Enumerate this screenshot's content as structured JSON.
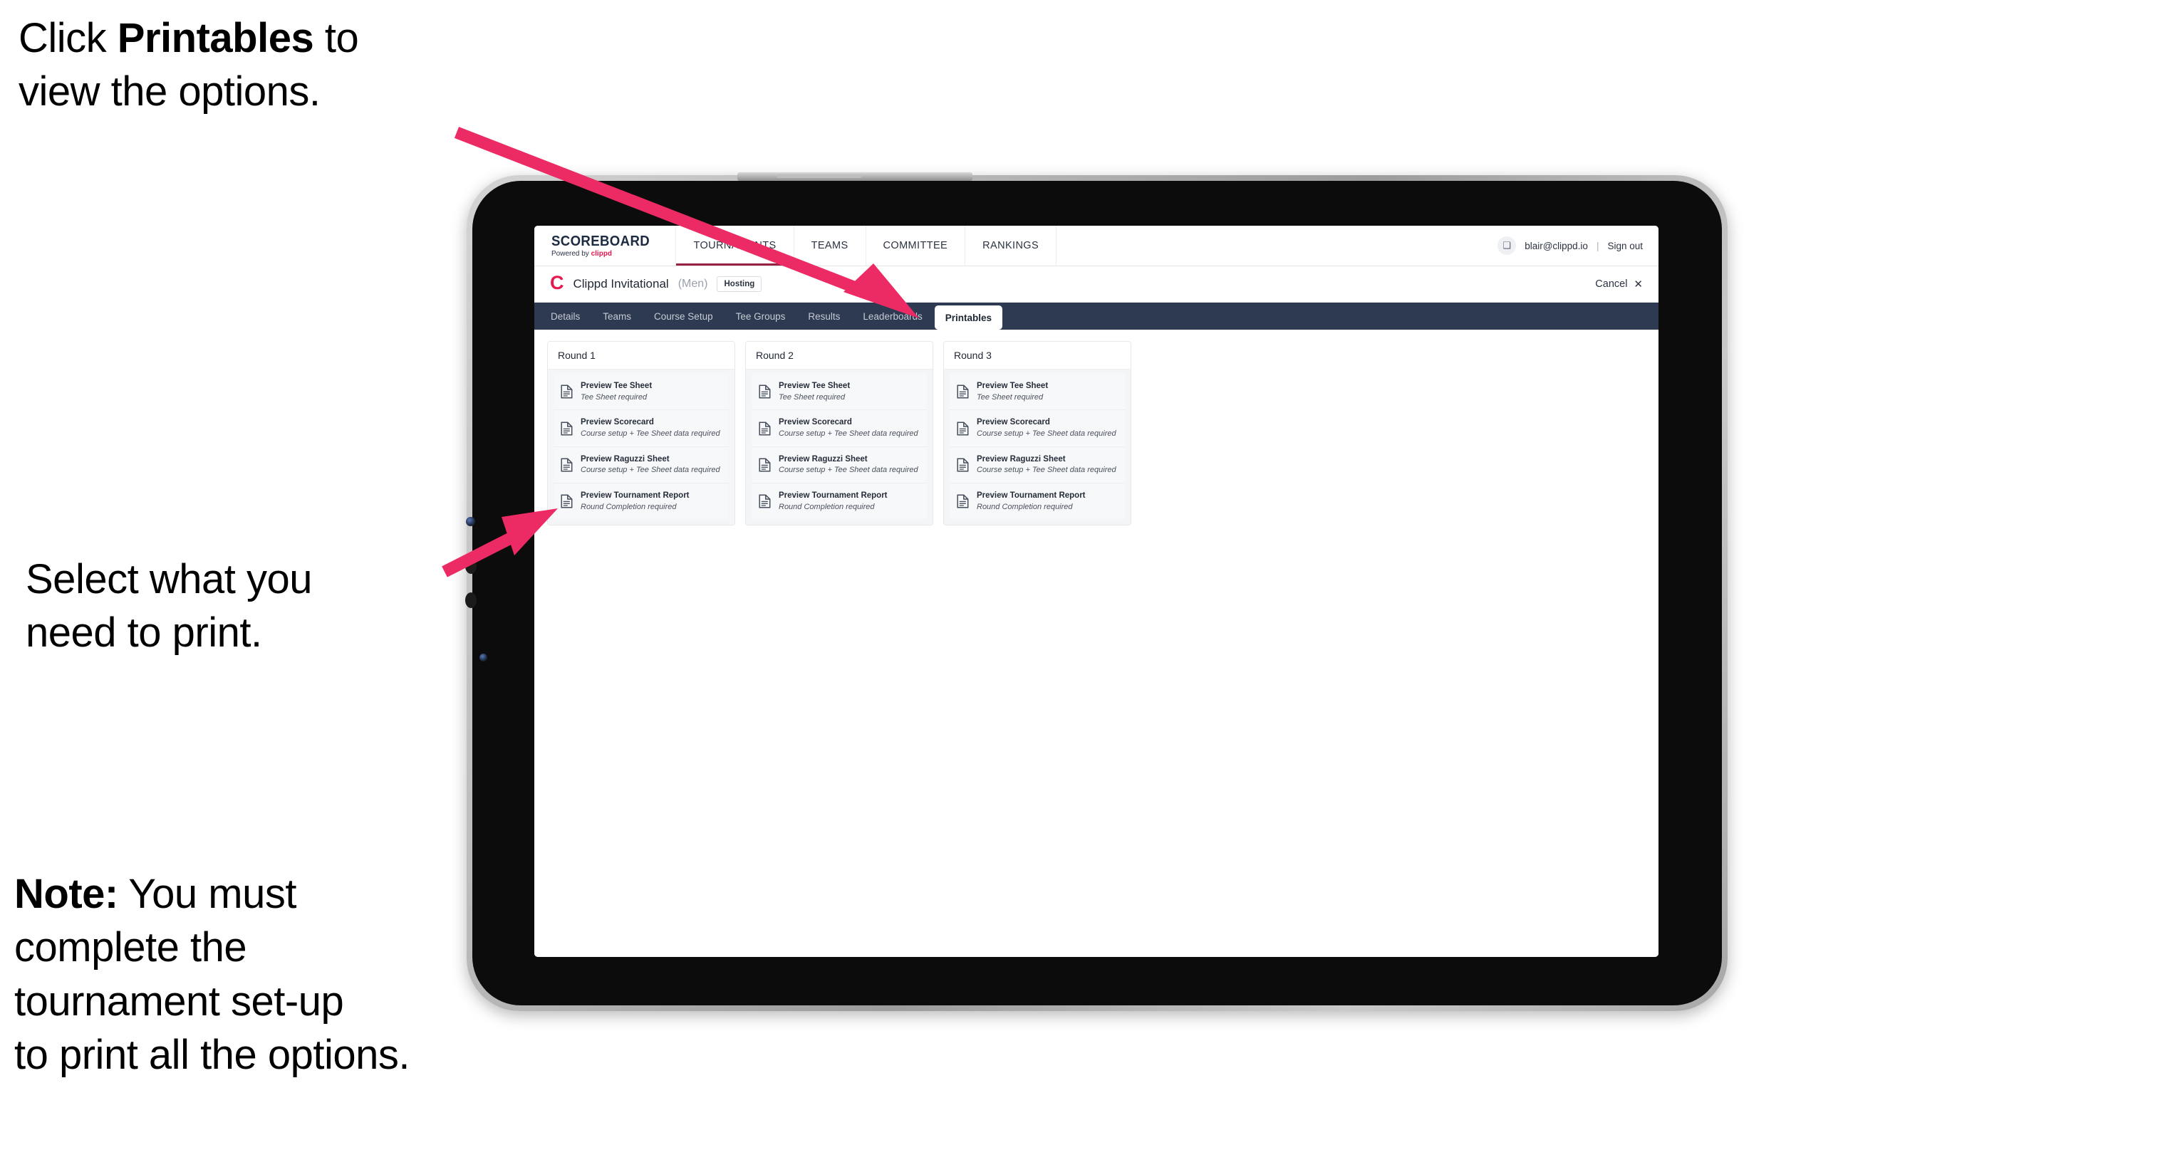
{
  "annotations": [
    {
      "id": "annot-click-printables",
      "text_before": "Click ",
      "text_bold": "Printables",
      "text_after": " to\nview the options."
    },
    {
      "id": "annot-select-print",
      "text_before": "",
      "text_bold": "",
      "text_after": "Select what you\n need to print."
    },
    {
      "id": "annot-note",
      "text_before": "",
      "text_bold": "Note:",
      "text_after": " You must\ncomplete the\ntournament set-up\nto print all the options."
    }
  ],
  "annotation_color": "#000000",
  "arrow_color": "#ec2a63",
  "app": {
    "brand": {
      "name": "SCOREBOARD",
      "powered_prefix": "Powered by ",
      "powered_brand": "clippd"
    },
    "topnav": [
      {
        "label": "TOURNAMENTS",
        "active": true
      },
      {
        "label": "TEAMS",
        "active": false
      },
      {
        "label": "COMMITTEE",
        "active": false
      },
      {
        "label": "RANKINGS",
        "active": false
      }
    ],
    "account": {
      "avatar_glyph": "❑",
      "email": "blair@clippd.io",
      "separator": "|",
      "sign_out": "Sign out"
    },
    "titlebar": {
      "logo_letter": "C",
      "tournament_name": "Clippd Invitational",
      "gender": "(Men)",
      "role_badge": "Hosting",
      "cancel_label": "Cancel",
      "cancel_icon": "✕"
    },
    "tabs": [
      {
        "label": "Details",
        "active": false
      },
      {
        "label": "Teams",
        "active": false
      },
      {
        "label": "Course Setup",
        "active": false
      },
      {
        "label": "Tee Groups",
        "active": false
      },
      {
        "label": "Results",
        "active": false
      },
      {
        "label": "Leaderboards",
        "active": false
      },
      {
        "label": "Printables",
        "active": true
      }
    ],
    "rounds": [
      {
        "title": "Round 1",
        "items": [
          {
            "title": "Preview Tee Sheet",
            "requirement": "Tee Sheet required"
          },
          {
            "title": "Preview Scorecard",
            "requirement": "Course setup + Tee Sheet data required"
          },
          {
            "title": "Preview Raguzzi Sheet",
            "requirement": "Course setup + Tee Sheet data required"
          },
          {
            "title": "Preview Tournament Report",
            "requirement": "Round Completion required"
          }
        ]
      },
      {
        "title": "Round 2",
        "items": [
          {
            "title": "Preview Tee Sheet",
            "requirement": "Tee Sheet required"
          },
          {
            "title": "Preview Scorecard",
            "requirement": "Course setup + Tee Sheet data required"
          },
          {
            "title": "Preview Raguzzi Sheet",
            "requirement": "Course setup + Tee Sheet data required"
          },
          {
            "title": "Preview Tournament Report",
            "requirement": "Round Completion required"
          }
        ]
      },
      {
        "title": "Round 3",
        "items": [
          {
            "title": "Preview Tee Sheet",
            "requirement": "Tee Sheet required"
          },
          {
            "title": "Preview Scorecard",
            "requirement": "Course setup + Tee Sheet data required"
          },
          {
            "title": "Preview Raguzzi Sheet",
            "requirement": "Course setup + Tee Sheet data required"
          },
          {
            "title": "Preview Tournament Report",
            "requirement": "Round Completion required"
          }
        ]
      }
    ],
    "colors": {
      "tabbar_bg": "#2e3a51",
      "brand_pink": "#e8174e",
      "active_underline": "#96203f",
      "card_bg": "#f7f8f9"
    }
  }
}
